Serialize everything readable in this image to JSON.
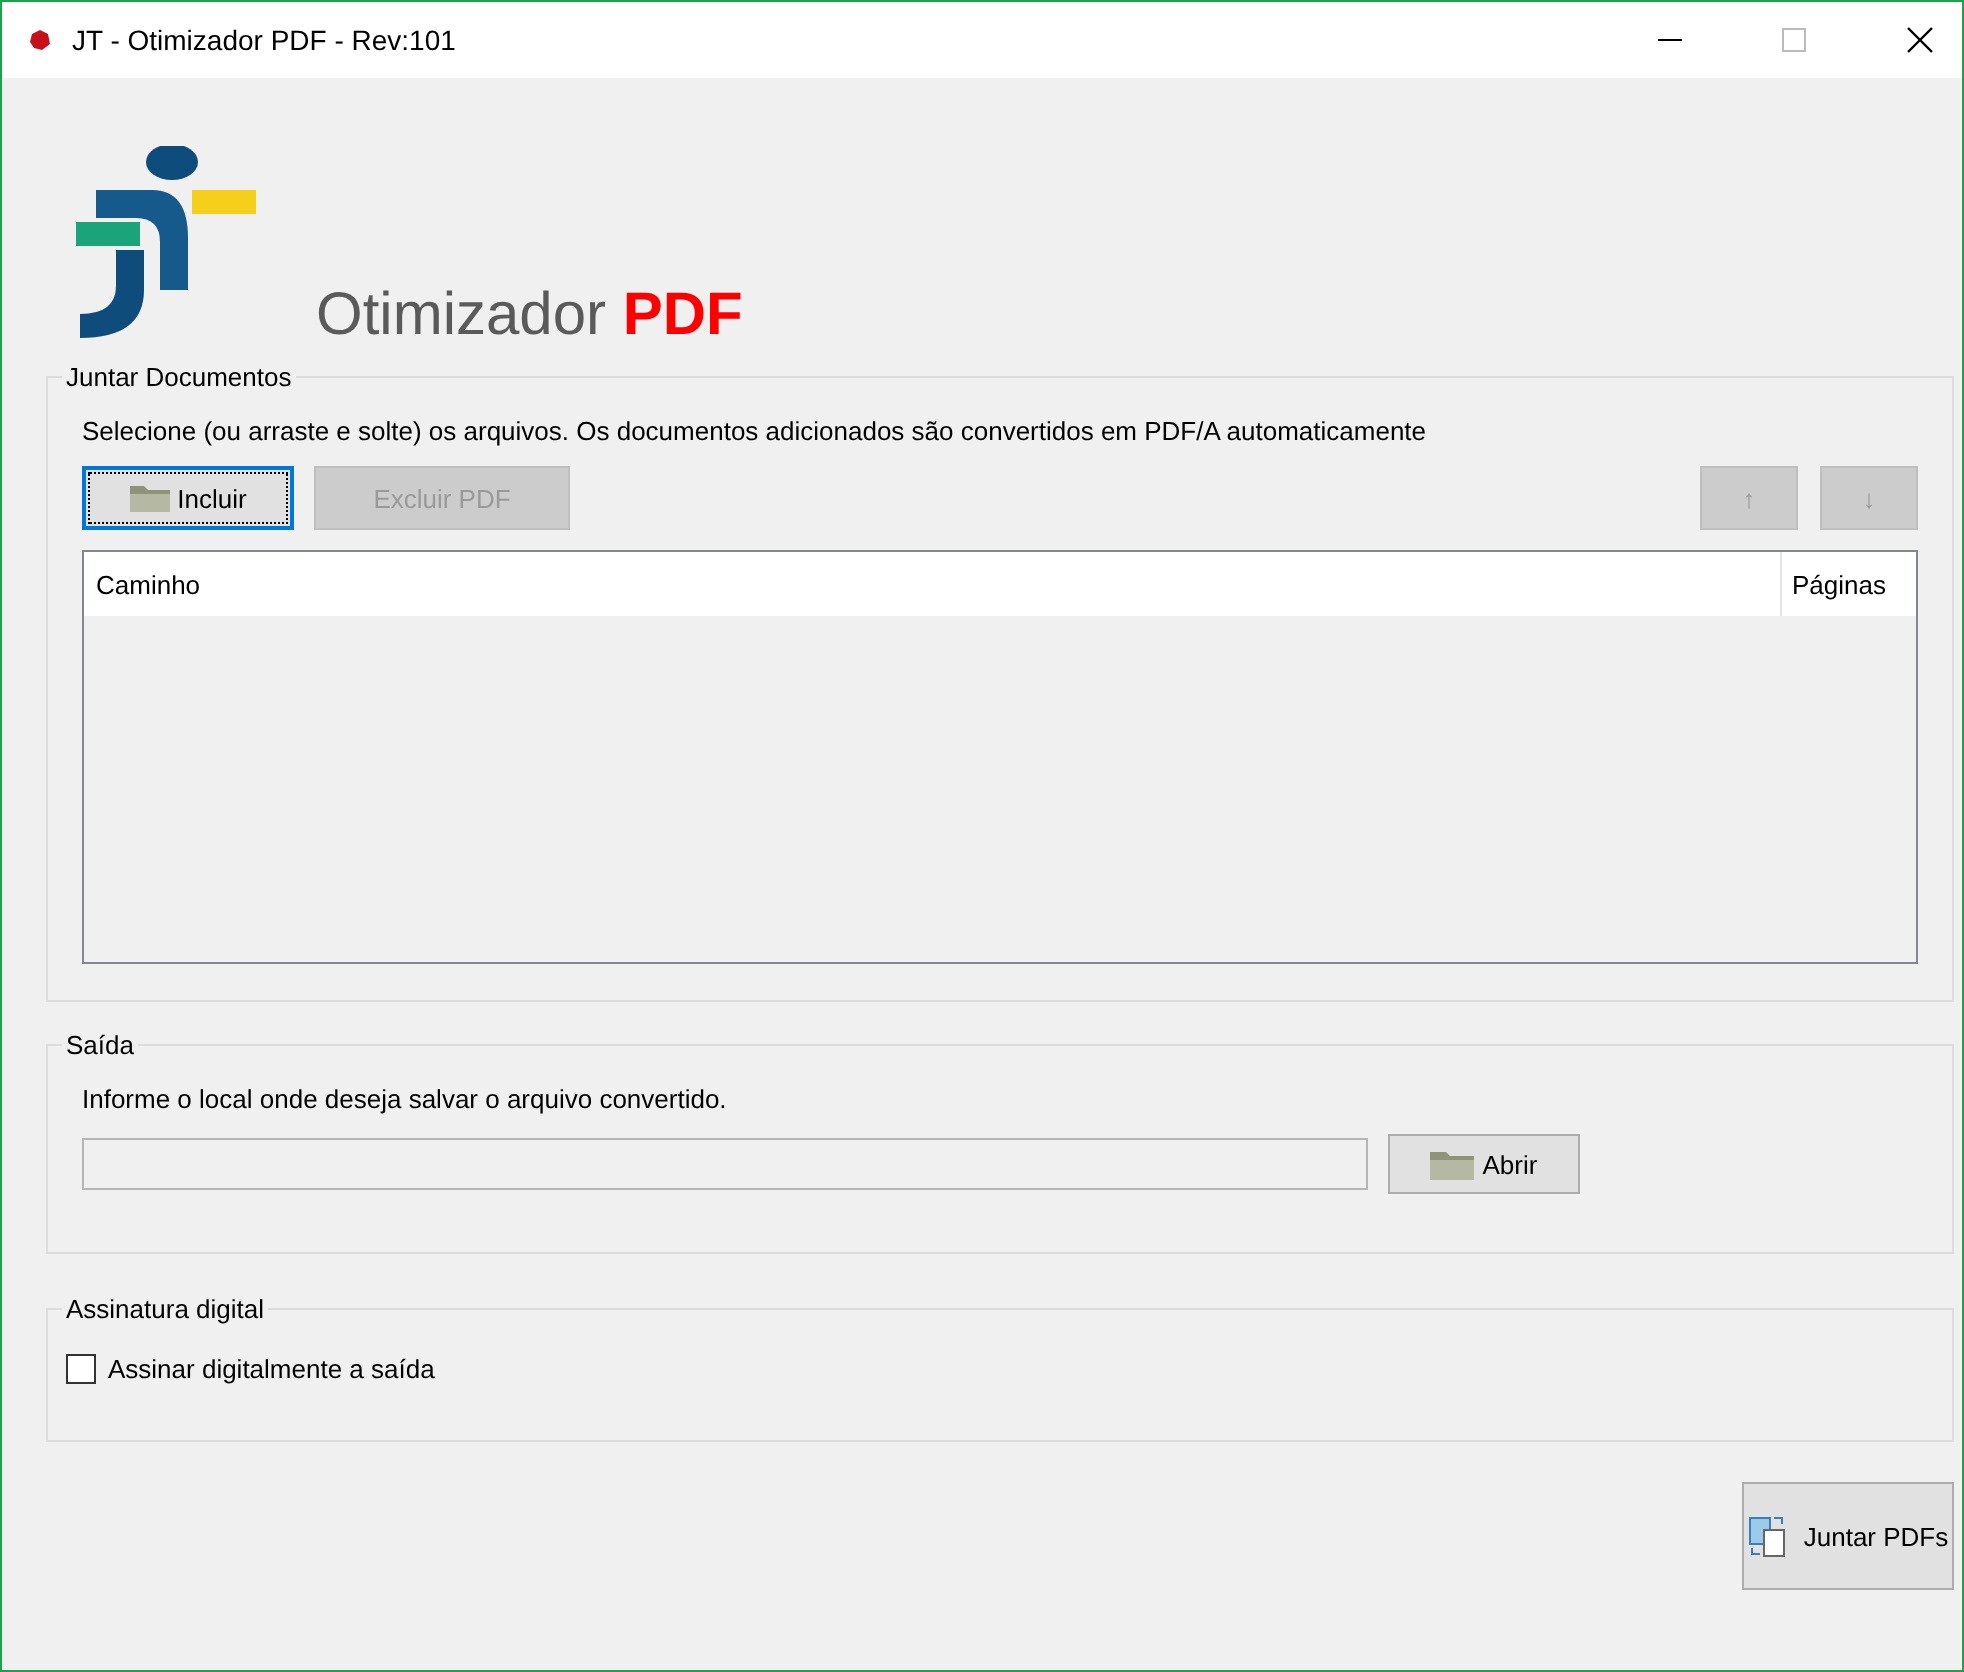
{
  "window": {
    "title": "JT - Otimizador PDF - Rev:101"
  },
  "logo": {
    "text": "Otimizador",
    "highlight": "PDF"
  },
  "merge_group": {
    "legend": "Juntar Documentos",
    "instructions": "Selecione (ou arraste e solte) os arquivos. Os documentos adicionados são convertidos em PDF/A automaticamente",
    "buttons": [
      {
        "kind": "file",
        "label": "Incluir",
        "disabled": false,
        "focused": true
      },
      {
        "kind": "text",
        "label": "Excluir PDF",
        "disabled": true,
        "focused": false
      }
    ],
    "move_buttons": [
      {
        "label": "↑",
        "disabled": true
      },
      {
        "label": "↓",
        "disabled": true
      }
    ],
    "table": {
      "columns": [
        "Caminho",
        "Páginas"
      ]
    }
  },
  "output_group": {
    "legend": "Saída",
    "instructions": "Informe o local onde deseja salvar o arquivo convertido.",
    "open_button": {
      "label": "Abrir"
    }
  },
  "signature_group": {
    "legend": "Assinatura digital",
    "checkbox": {
      "label": "Assinar digitalmente a saída",
      "checked": false
    }
  },
  "merge_button": {
    "label": "Juntar PDFs"
  }
}
